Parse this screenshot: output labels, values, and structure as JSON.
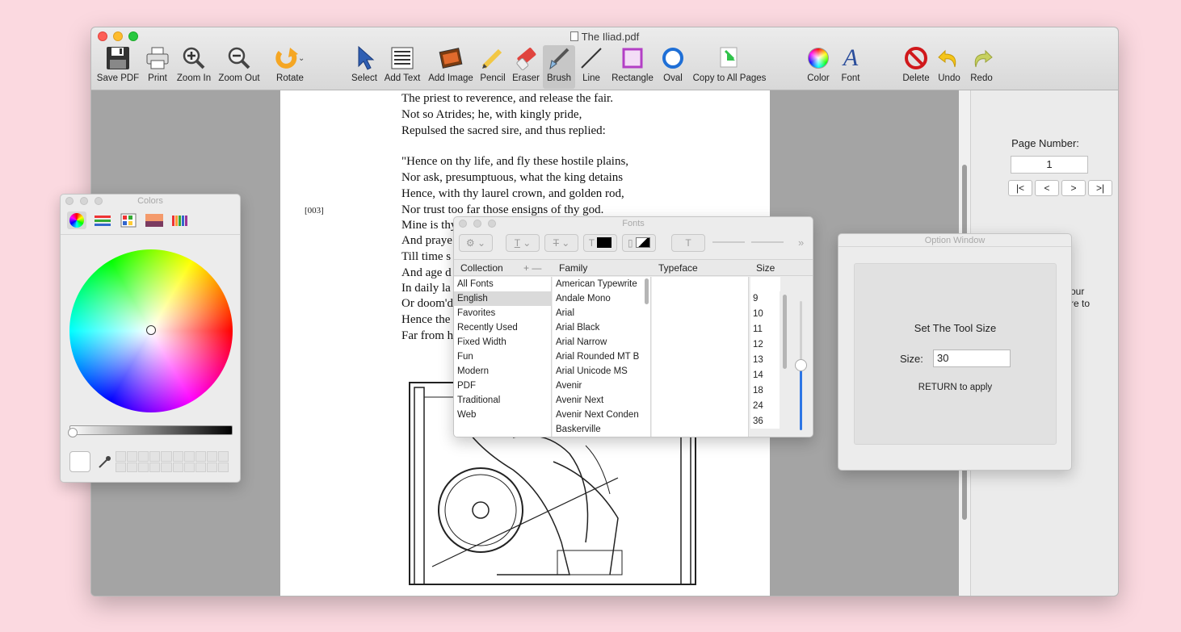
{
  "window": {
    "title": "The Iliad.pdf"
  },
  "toolbar": {
    "tools": [
      {
        "id": "save-pdf",
        "label": "Save PDF",
        "icon": "floppy-icon"
      },
      {
        "id": "print",
        "label": "Print",
        "icon": "printer-icon"
      },
      {
        "id": "zoom-in",
        "label": "Zoom In",
        "icon": "zoom-in-icon"
      },
      {
        "id": "zoom-out",
        "label": "Zoom Out",
        "icon": "zoom-out-icon"
      },
      {
        "id": "rotate",
        "label": "Rotate",
        "icon": "rotate-icon"
      },
      {
        "id": "select",
        "label": "Select",
        "icon": "arrow-cursor-icon"
      },
      {
        "id": "add-text",
        "label": "Add Text",
        "icon": "text-lines-icon"
      },
      {
        "id": "add-image",
        "label": "Add Image",
        "icon": "image-icon"
      },
      {
        "id": "pencil",
        "label": "Pencil",
        "icon": "pencil-icon"
      },
      {
        "id": "eraser",
        "label": "Eraser",
        "icon": "eraser-icon"
      },
      {
        "id": "brush",
        "label": "Brush",
        "icon": "brush-icon"
      },
      {
        "id": "line",
        "label": "Line",
        "icon": "line-icon"
      },
      {
        "id": "rectangle",
        "label": "Rectangle",
        "icon": "rectangle-icon"
      },
      {
        "id": "oval",
        "label": "Oval",
        "icon": "oval-icon"
      },
      {
        "id": "copy-all",
        "label": "Copy to All Pages",
        "icon": "copy-pages-icon"
      },
      {
        "id": "color",
        "label": "Color",
        "icon": "color-wheel-icon"
      },
      {
        "id": "font",
        "label": "Font",
        "icon": "font-icon"
      },
      {
        "id": "delete",
        "label": "Delete",
        "icon": "delete-icon"
      },
      {
        "id": "undo",
        "label": "Undo",
        "icon": "undo-icon"
      },
      {
        "id": "redo",
        "label": "Redo",
        "icon": "redo-icon"
      }
    ],
    "active": "Brush"
  },
  "document": {
    "lines": [
      "The priest to reverence, and release the fair.",
      "Not so Atrides; he, with kingly pride,",
      "Repulsed the sacred sire, and thus replied:",
      "\"Hence on thy life, and fly these hostile plains,",
      "Nor ask, presumptuous, what the king detains",
      "Hence, with thy laurel crown, and golden rod,",
      "Nor trust too far those ensigns of thy god.",
      "Mine is thy",
      "And praye",
      "Till time s",
      "And age d",
      "In daily la",
      "Or doom'd",
      "Hence the",
      "Far from h"
    ],
    "marker": "[003]"
  },
  "sidebar": {
    "page_number_label": "Page Number:",
    "page_number": "1",
    "nav": [
      "|<",
      "<",
      ">",
      ">|"
    ],
    "hint_line1": "our",
    "hint_line2": "re to"
  },
  "colors_panel": {
    "title": "Colors",
    "tabs": [
      "color-wheel-tab",
      "sliders-tab",
      "palettes-tab",
      "image-palettes-tab",
      "pencils-tab"
    ]
  },
  "fonts_panel": {
    "title": "Fonts",
    "headers": {
      "collection": "Collection",
      "family": "Family",
      "typeface": "Typeface",
      "size": "Size"
    },
    "collections": [
      "All Fonts",
      "English",
      "Favorites",
      "Recently Used",
      "Fixed Width",
      "Fun",
      "Modern",
      "PDF",
      "Traditional",
      "Web"
    ],
    "selected_collection": "English",
    "families": [
      "American Typewrite",
      "Andale Mono",
      "Arial",
      "Arial Black",
      "Arial Narrow",
      "Arial Rounded MT B",
      "Arial Unicode MS",
      "Avenir",
      "Avenir Next",
      "Avenir Next Conden",
      "Baskerville"
    ],
    "sizes": [
      "9",
      "10",
      "11",
      "12",
      "13",
      "14",
      "18",
      "24",
      "36"
    ]
  },
  "option_window": {
    "title": "Option Window",
    "heading": "Set The Tool Size",
    "size_label": "Size:",
    "size_value": "30",
    "hint": "RETURN to apply"
  }
}
